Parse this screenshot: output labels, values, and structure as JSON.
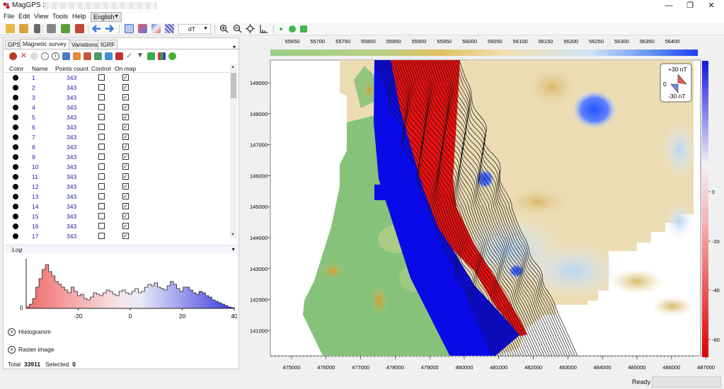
{
  "window": {
    "title": "MagGPS 2.2",
    "minimize": "—",
    "maximize": "❐",
    "close": "✕"
  },
  "menu": {
    "items": [
      "File",
      "Edit",
      "View",
      "Tools",
      "Help"
    ],
    "language": "English"
  },
  "toolbar": {
    "component": "dT",
    "icons": [
      "open-folder-icon",
      "import-icon",
      "save-icon",
      "print-icon",
      "export-icon",
      "print-preview-icon",
      "back-arrow-icon",
      "forward-arrow-icon",
      "chart-icon",
      "grid-map-icon",
      "contour-map-icon",
      "hatch-map-icon",
      "zoom-in-icon",
      "zoom-out-icon",
      "zoom-fit-icon",
      "measure-icon",
      "small-dot-icon",
      "green-dot-icon",
      "green-square-icon"
    ]
  },
  "tabs": [
    {
      "label": "GPS",
      "active": false
    },
    {
      "label": "Magnetic survey",
      "active": true
    },
    {
      "label": "Variations",
      "active": false
    },
    {
      "label": "IGRF",
      "active": false
    }
  ],
  "survey_table": {
    "headers": [
      "Color",
      "Name",
      "Points count",
      "Control",
      "On map"
    ],
    "rows": [
      {
        "name": "1",
        "points": "343",
        "control": false,
        "on_map": true
      },
      {
        "name": "2",
        "points": "343",
        "control": false,
        "on_map": true
      },
      {
        "name": "3",
        "points": "343",
        "control": false,
        "on_map": true
      },
      {
        "name": "4",
        "points": "343",
        "control": false,
        "on_map": true
      },
      {
        "name": "5",
        "points": "343",
        "control": false,
        "on_map": true
      },
      {
        "name": "6",
        "points": "343",
        "control": false,
        "on_map": true
      },
      {
        "name": "7",
        "points": "343",
        "control": false,
        "on_map": true
      },
      {
        "name": "8",
        "points": "343",
        "control": false,
        "on_map": true
      },
      {
        "name": "9",
        "points": "343",
        "control": false,
        "on_map": true
      },
      {
        "name": "10",
        "points": "343",
        "control": false,
        "on_map": true
      },
      {
        "name": "11",
        "points": "343",
        "control": false,
        "on_map": true
      },
      {
        "name": "12",
        "points": "343",
        "control": false,
        "on_map": true
      },
      {
        "name": "13",
        "points": "343",
        "control": false,
        "on_map": true
      },
      {
        "name": "14",
        "points": "343",
        "control": false,
        "on_map": true
      },
      {
        "name": "15",
        "points": "343",
        "control": false,
        "on_map": true
      },
      {
        "name": "16",
        "points": "343",
        "control": false,
        "on_map": true
      },
      {
        "name": "17",
        "points": "343",
        "control": false,
        "on_map": true
      }
    ]
  },
  "log": {
    "title": "Log"
  },
  "histogram": {
    "x_ticks": [
      "-20",
      "0",
      "20",
      "40"
    ],
    "x_tick_values": [
      -20,
      0,
      20,
      40
    ],
    "x_range": [
      -40,
      40
    ],
    "y_zero_label": "0"
  },
  "sections": {
    "histogram": "Histogramm",
    "raster": "Raster image"
  },
  "totals": {
    "total_label": "Total",
    "total_value": "33911",
    "selected_label": "Selected",
    "selected_value": "0"
  },
  "status": {
    "text": "Ready"
  },
  "map": {
    "x_axis_top": [
      "55650",
      "55700",
      "55750",
      "55800",
      "55850",
      "55900",
      "55950",
      "56000",
      "56050",
      "56100",
      "56150",
      "56200",
      "56250",
      "56300",
      "56350",
      "56400"
    ],
    "x_axis_bottom": [
      "475000",
      "476000",
      "477000",
      "478000",
      "479000",
      "480000",
      "481000",
      "482000",
      "483000",
      "484000",
      "485000",
      "486000",
      "487000"
    ],
    "y_axis": [
      "149000",
      "148000",
      "147000",
      "146000",
      "145000",
      "144000",
      "143000",
      "142000",
      "141000"
    ],
    "colorbar_ticks": [
      "0",
      "-20",
      "-40",
      "-60"
    ],
    "legend": {
      "plus": "+30  nT",
      "zero": "0",
      "minus": "-30  nT"
    },
    "colors": {
      "blue": "#0000ff",
      "red": "#ff0000",
      "green": "#76bd6a",
      "tan": "#e8d6a8"
    }
  }
}
